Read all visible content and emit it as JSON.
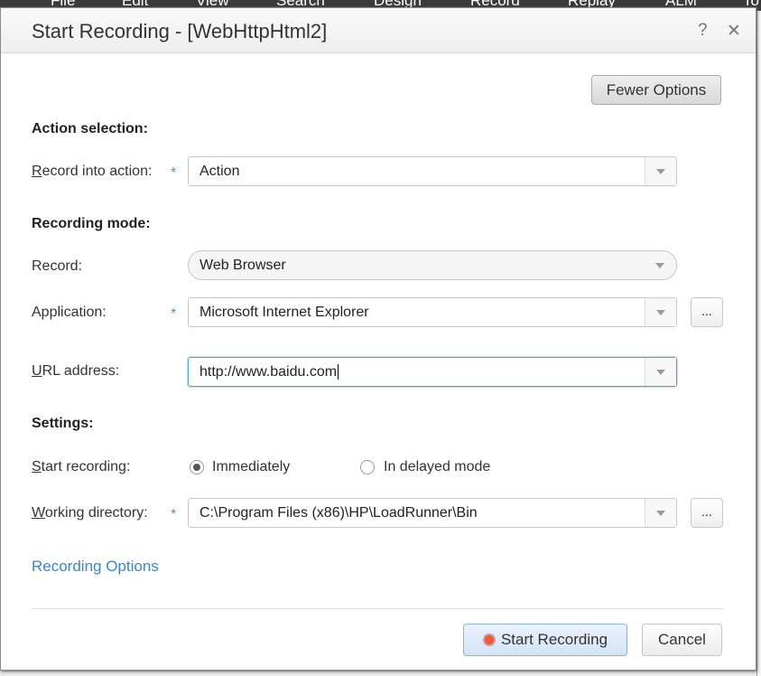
{
  "background_menu": [
    "File",
    "Edit",
    "View",
    "Search",
    "Design",
    "Record",
    "Replay",
    "ALM",
    "To"
  ],
  "dialog": {
    "title": "Start Recording - [WebHttpHtml2]",
    "help": "?",
    "close": "✕"
  },
  "fewer_options": "Fewer Options",
  "action_section": {
    "heading": "Action selection:",
    "record_into_label_u": "R",
    "record_into_label": "ecord into action:",
    "record_into_value": "Action"
  },
  "mode_section": {
    "heading": "Recording mode:",
    "record_label": "Record:",
    "record_value": "Web Browser",
    "application_label": "Application:",
    "application_value": "Microsoft Internet Explorer",
    "url_label_u": "U",
    "url_label": "RL address:",
    "url_value": "http://www.baidu.com"
  },
  "settings": {
    "heading": "Settings:",
    "start_label_u": "S",
    "start_label": "tart recording:",
    "immediately": "Immediately",
    "delayed": "In delayed mode",
    "selected": "Immediately",
    "workdir_label_u": "W",
    "workdir_label": "orking directory:",
    "workdir_value": "C:\\Program Files (x86)\\HP\\LoadRunner\\Bin"
  },
  "browse": "...",
  "required_mark": "*",
  "recording_options_link": "Recording Options",
  "buttons": {
    "start": "Start Recording",
    "cancel": "Cancel"
  },
  "colors": {
    "link": "#3a84d0",
    "record_dot": "#f05a28",
    "required": "#4a90d9"
  }
}
